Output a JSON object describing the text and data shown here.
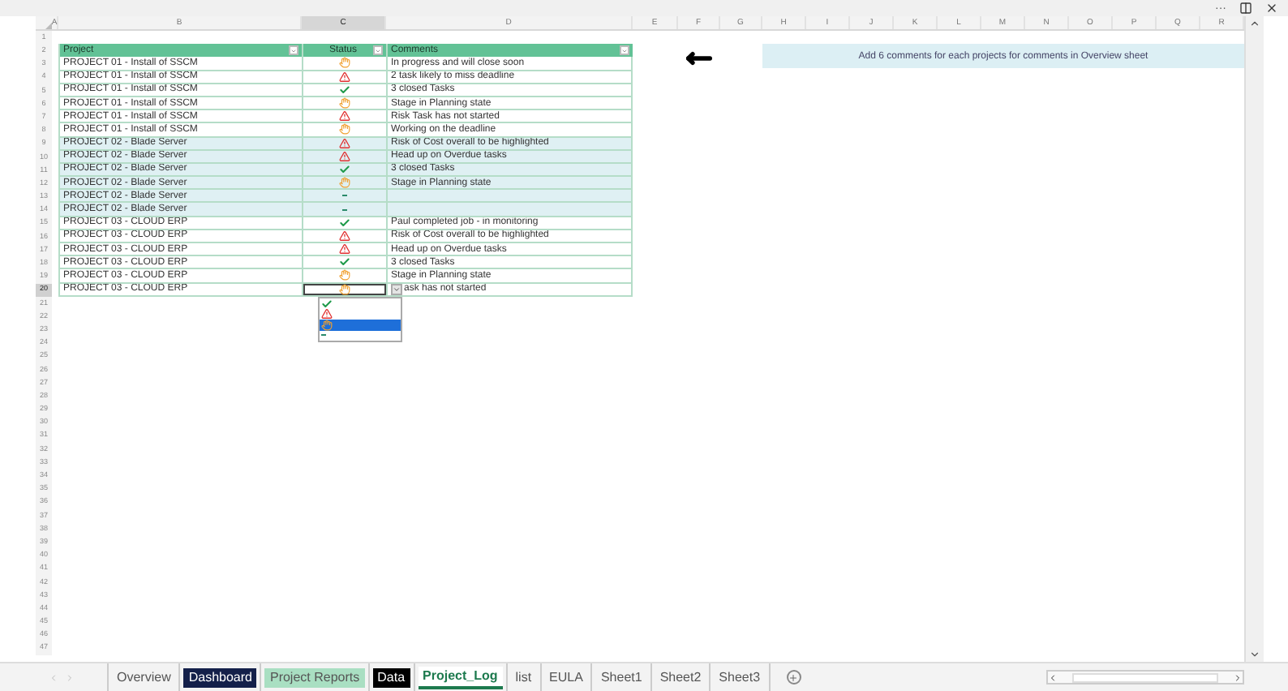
{
  "window_controls": {
    "more": "···"
  },
  "columns": [
    {
      "label": "A",
      "selected": false
    },
    {
      "label": "B",
      "selected": false
    },
    {
      "label": "C",
      "selected": true
    },
    {
      "label": "D",
      "selected": false
    },
    {
      "label": "E",
      "selected": false
    },
    {
      "label": "F",
      "selected": false
    },
    {
      "label": "G",
      "selected": false
    },
    {
      "label": "H",
      "selected": false
    },
    {
      "label": "I",
      "selected": false
    },
    {
      "label": "J",
      "selected": false
    },
    {
      "label": "K",
      "selected": false
    },
    {
      "label": "L",
      "selected": false
    },
    {
      "label": "M",
      "selected": false
    },
    {
      "label": "N",
      "selected": false
    },
    {
      "label": "O",
      "selected": false
    },
    {
      "label": "P",
      "selected": false
    },
    {
      "label": "Q",
      "selected": false
    },
    {
      "label": "R",
      "selected": false
    }
  ],
  "row_numbers": [
    {
      "label": "1",
      "selected": false
    },
    {
      "label": "2",
      "selected": false
    },
    {
      "label": "3",
      "selected": false
    },
    {
      "label": "4",
      "selected": false
    },
    {
      "label": "5",
      "selected": false
    },
    {
      "label": "6",
      "selected": false
    },
    {
      "label": "7",
      "selected": false
    },
    {
      "label": "8",
      "selected": false
    },
    {
      "label": "9",
      "selected": false
    },
    {
      "label": "10",
      "selected": false
    },
    {
      "label": "11",
      "selected": false
    },
    {
      "label": "12",
      "selected": false
    },
    {
      "label": "13",
      "selected": false
    },
    {
      "label": "14",
      "selected": false
    },
    {
      "label": "15",
      "selected": false
    },
    {
      "label": "16",
      "selected": false
    },
    {
      "label": "17",
      "selected": false
    },
    {
      "label": "18",
      "selected": false
    },
    {
      "label": "19",
      "selected": false
    },
    {
      "label": "20",
      "selected": true
    },
    {
      "label": "21",
      "selected": false
    },
    {
      "label": "22",
      "selected": false
    },
    {
      "label": "23",
      "selected": false
    },
    {
      "label": "24",
      "selected": false
    },
    {
      "label": "25",
      "selected": false
    },
    {
      "label": "26",
      "selected": false
    },
    {
      "label": "27",
      "selected": false
    },
    {
      "label": "28",
      "selected": false
    },
    {
      "label": "29",
      "selected": false
    },
    {
      "label": "30",
      "selected": false
    },
    {
      "label": "31",
      "selected": false
    },
    {
      "label": "32",
      "selected": false
    },
    {
      "label": "33",
      "selected": false
    },
    {
      "label": "34",
      "selected": false
    },
    {
      "label": "35",
      "selected": false
    },
    {
      "label": "36",
      "selected": false
    },
    {
      "label": "37",
      "selected": false
    },
    {
      "label": "38",
      "selected": false
    },
    {
      "label": "39",
      "selected": false
    },
    {
      "label": "40",
      "selected": false
    },
    {
      "label": "41",
      "selected": false
    },
    {
      "label": "42",
      "selected": false
    },
    {
      "label": "43",
      "selected": false
    },
    {
      "label": "44",
      "selected": false
    },
    {
      "label": "45",
      "selected": false
    },
    {
      "label": "46",
      "selected": false
    },
    {
      "label": "47",
      "selected": false
    }
  ],
  "table": {
    "columns": [
      "Project",
      "Status",
      "Comments"
    ],
    "rows": [
      {
        "project": "PROJECT 01 - Install of SSCM",
        "kind": "pending",
        "comment": "In progress and will close soon",
        "highlighted": false,
        "selected": false
      },
      {
        "project": "PROJECT 01 - Install of SSCM",
        "kind": "warning",
        "comment": "2 task likely to miss deadline",
        "highlighted": false,
        "selected": false
      },
      {
        "project": "PROJECT 01 - Install of SSCM",
        "kind": "done",
        "comment": "3 closed Tasks",
        "highlighted": false,
        "selected": false
      },
      {
        "project": "PROJECT 01 - Install of SSCM",
        "kind": "pending",
        "comment": "Stage in Planning state",
        "highlighted": false,
        "selected": false
      },
      {
        "project": "PROJECT 01 - Install of SSCM",
        "kind": "warning",
        "comment": "Risk Task has not started",
        "highlighted": false,
        "selected": false
      },
      {
        "project": "PROJECT 01 - Install of SSCM",
        "kind": "pending",
        "comment": "Working on the deadline",
        "highlighted": false,
        "selected": false
      },
      {
        "project": "PROJECT 02 - Blade Server",
        "kind": "warning",
        "comment": "Risk of Cost overall to be highlighted",
        "highlighted": true,
        "selected": false
      },
      {
        "project": "PROJECT 02 - Blade Server",
        "kind": "warning",
        "comment": "Head up on Overdue tasks",
        "highlighted": true,
        "selected": false
      },
      {
        "project": "PROJECT 02 - Blade Server",
        "kind": "done",
        "comment": "3 closed Tasks",
        "highlighted": true,
        "selected": false
      },
      {
        "project": "PROJECT 02 - Blade Server",
        "kind": "pending",
        "comment": "Stage in Planning state",
        "highlighted": true,
        "selected": false
      },
      {
        "project": "PROJECT 02 - Blade Server",
        "kind": "none",
        "highlighted": true,
        "selected": false
      },
      {
        "project": "PROJECT 02 - Blade Server",
        "kind": "none",
        "highlighted": true,
        "selected": false
      },
      {
        "project": "PROJECT 03 - CLOUD ERP",
        "kind": "done",
        "comment": "Paul completed job - in monitoring",
        "highlighted": false,
        "selected": false
      },
      {
        "project": "PROJECT 03 - CLOUD ERP",
        "kind": "warning",
        "comment": "Risk of Cost overall to be highlighted",
        "highlighted": false,
        "selected": false
      },
      {
        "project": "PROJECT 03 - CLOUD ERP",
        "kind": "warning",
        "comment": "Head up on Overdue tasks",
        "highlighted": false,
        "selected": false
      },
      {
        "project": "PROJECT 03 - CLOUD ERP",
        "kind": "done",
        "comment": "3 closed Tasks",
        "highlighted": false,
        "selected": false
      },
      {
        "project": "PROJECT 03 - CLOUD ERP",
        "kind": "pending",
        "comment": "Stage in Planning state",
        "highlighted": false,
        "selected": false
      },
      {
        "project": "PROJECT 03 - CLOUD ERP",
        "kind": "pending",
        "comment": "ask has not started",
        "highlighted": false,
        "selected": true
      }
    ]
  },
  "dropdown": {
    "options": [
      {
        "kind": "done",
        "selected": false
      },
      {
        "kind": "warning",
        "selected": false
      },
      {
        "kind": "pending",
        "selected": true
      },
      {
        "kind": "none",
        "selected": false
      }
    ]
  },
  "note": {
    "text": "Add 6 comments for each projects for comments in Overview sheet"
  },
  "sheet_tabs": [
    {
      "label": "Overview",
      "selected": false
    },
    {
      "label": "Dashboard",
      "color": "#14204a",
      "selected": false
    },
    {
      "label": "Project Reports",
      "color": "#a9dfc2",
      "selected": false
    },
    {
      "label": "Data",
      "color": "#000000",
      "selected": false
    },
    {
      "label": "Project_Log",
      "selected": true
    },
    {
      "label": "list",
      "selected": false
    },
    {
      "label": "EULA",
      "selected": false
    },
    {
      "label": "Sheet1",
      "selected": false
    },
    {
      "label": "Sheet2",
      "selected": false
    },
    {
      "label": "Sheet3",
      "selected": false
    }
  ]
}
